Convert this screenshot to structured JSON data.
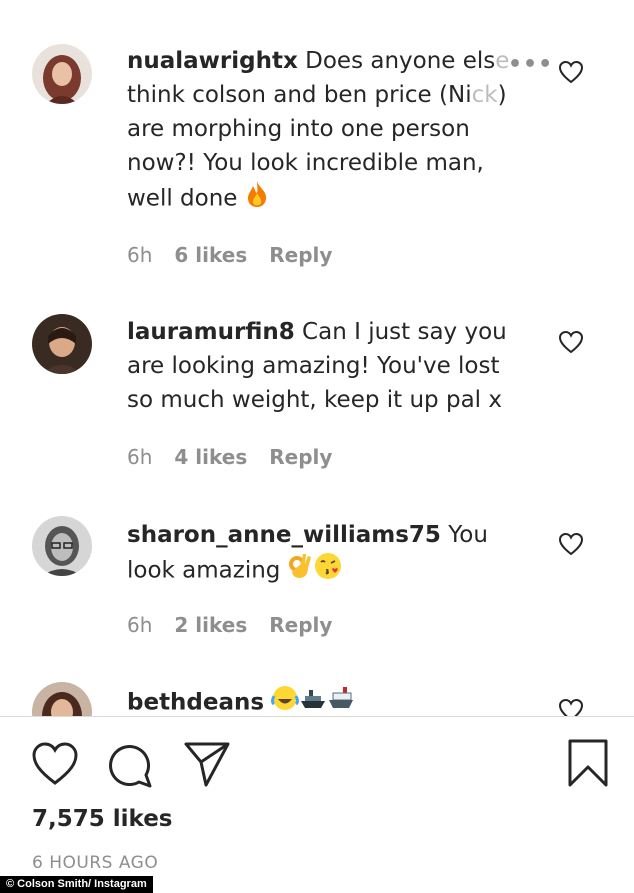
{
  "comments": [
    {
      "username": "nualawrightx",
      "text_main": " Does anyone els",
      "text_fade1": "e",
      "text_line2a": "think colson and ben price (Ni",
      "text_fade2": "ck",
      "text_line2b": ")",
      "text_rest": "are morphing into one person now?! You look incredible man, well done",
      "emoji": "fire",
      "time": "6h",
      "likes": "6 likes",
      "reply": "Reply"
    },
    {
      "username": "lauramurfin8",
      "text": " Can I just say you are looking amazing! You've lost so much weight, keep it up pal x",
      "time": "6h",
      "likes": "4 likes",
      "reply": "Reply"
    },
    {
      "username": "sharon_anne_williams75",
      "text": " You look amazing",
      "emoji": "ok-hand, kissing-face",
      "time": "6h",
      "likes": "2 likes",
      "reply": "Reply"
    },
    {
      "username": "bethdeans",
      "emoji": "crying-laughing, ship, ship"
    }
  ],
  "likes_total": "7,575 likes",
  "time_ago": "6 HOURS AGO",
  "credit": "© Colson Smith/ Instagram",
  "colors": {
    "text": "#262626",
    "meta": "#8e8e8e",
    "divider": "#dbdbdb"
  }
}
